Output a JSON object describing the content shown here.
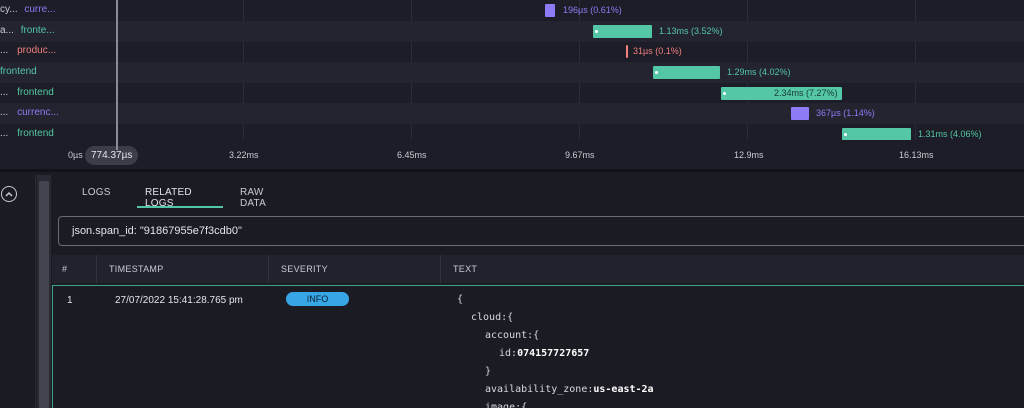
{
  "trace": {
    "rows": [
      {
        "op": "cy...",
        "service": "curre...",
        "color": "#8b7cf6",
        "span_label": "196µs (0.61%)"
      },
      {
        "op": "a...",
        "service": "fronte...",
        "color": "#53c7a6",
        "span_label": "1.13ms (3.52%)"
      },
      {
        "op": "...",
        "service": "produc...",
        "color": "#f27f7f",
        "span_label": "31µs (0.1%)"
      },
      {
        "op": "",
        "service": "frontend",
        "color": "#53c7a6",
        "span_label": "1.29ms (4.02%)"
      },
      {
        "op": "...",
        "service": "frontend",
        "color": "#53c7a6",
        "span_label": "2.34ms (7.27%)"
      },
      {
        "op": "...",
        "service": "currenc...",
        "color": "#8b7cf6",
        "span_label": "367µs (1.14%)"
      },
      {
        "op": "...",
        "service": "frontend",
        "color": "#53c7a6",
        "span_label": "1.31ms (4.06%)"
      }
    ],
    "axis_ticks": [
      "0µs",
      "3.22ms",
      "6.45ms",
      "9.67ms",
      "12.9ms",
      "16.13ms"
    ],
    "cursor_value": "774.37µs"
  },
  "tabs": [
    {
      "label": "LOGS"
    },
    {
      "label": "RELATED LOGS"
    },
    {
      "label": "RAW DATA"
    }
  ],
  "query": "json.span_id: \"91867955e7f3cdb0\"",
  "table": {
    "headers": [
      "#",
      "TIMESTAMP",
      "SEVERITY",
      "TEXT"
    ],
    "row": {
      "index": "1",
      "timestamp": "27/07/2022 15:41:28.765 pm",
      "severity": "INFO",
      "json_lines": [
        {
          "key": "{",
          "value": ""
        },
        {
          "key": "cloud:{",
          "value": ""
        },
        {
          "key": "account:{",
          "value": ""
        },
        {
          "key": "id:",
          "value": "074157727657"
        },
        {
          "key": "}",
          "value": ""
        },
        {
          "key": "availability_zone:",
          "value": "us-east-2a"
        },
        {
          "key": "image:{",
          "value": ""
        }
      ]
    }
  },
  "colors": {
    "accent": "#53c7a6",
    "violet": "#8b7cf6",
    "red": "#f27f7f",
    "info": "#36a6e6"
  }
}
